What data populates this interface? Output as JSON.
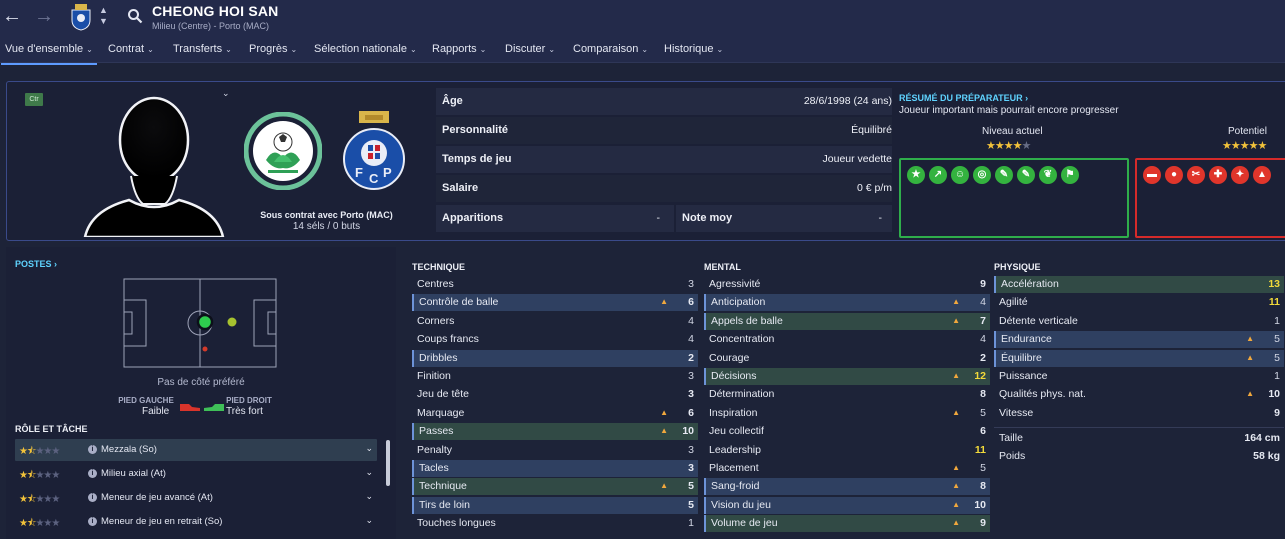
{
  "header": {
    "player_name": "CHEONG HOI SAN",
    "player_subtitle": "Milieu (Centre) - Porto (MAC)"
  },
  "tabs": [
    {
      "label": "Vue d'ensemble"
    },
    {
      "label": "Contrat"
    },
    {
      "label": "Transferts"
    },
    {
      "label": "Progrès"
    },
    {
      "label": "Sélection nationale"
    },
    {
      "label": "Rapports"
    },
    {
      "label": "Discuter"
    },
    {
      "label": "Comparaison"
    },
    {
      "label": "Historique"
    }
  ],
  "profile": {
    "position_badge": "Ctr",
    "contract": "Sous contrat avec Porto (MAC)",
    "caps": "14 séls / 0 buts",
    "info": {
      "age_label": "Âge",
      "age_value": "28/6/1998 (24 ans)",
      "personality_label": "Personnalité",
      "personality_value": "Équilibré",
      "playing_time_label": "Temps de jeu",
      "playing_time_value": "Joueur vedette",
      "salary_label": "Salaire",
      "salary_value": "0 € p/m",
      "appearances_label": "Apparitions",
      "appearances_value": "-",
      "rating_label": "Note moy",
      "rating_value": "-"
    }
  },
  "coach": {
    "title": "RÉSUMÉ DU PRÉPARATEUR ›",
    "summary": "Joueur important mais pourrait encore progresser",
    "current_label": "Niveau actuel",
    "potential_label": "Potentiel",
    "current_stars": 3.5,
    "potential_stars": 4.5,
    "strength_icons": [
      "star-icon",
      "trend-icon",
      "head-icon",
      "target-icon",
      "boot-icon",
      "boot-icon",
      "boots-icon",
      "flag-icon"
    ],
    "weakness_icons": [
      "dumbbell-icon",
      "ball-icon",
      "scissors-icon",
      "cross-icon",
      "foot-icon",
      "cone-icon"
    ]
  },
  "positions": {
    "title": "POSTES ›",
    "preferred_side": "Pas de côté préféré",
    "left_foot_label": "PIED GAUCHE",
    "left_foot_value": "Faible",
    "right_foot_label": "PIED DROIT",
    "right_foot_value": "Très fort"
  },
  "roles": {
    "title": "RÔLE ET TÂCHE",
    "items": [
      {
        "name": "Mezzala (So)",
        "stars": 1.5
      },
      {
        "name": "Milieu axial (At)",
        "stars": 1.5
      },
      {
        "name": "Meneur de jeu avancé (At)",
        "stars": 1.5
      },
      {
        "name": "Meneur de jeu en retrait (So)",
        "stars": 1.5
      }
    ]
  },
  "attributes": {
    "technical_title": "TECHNIQUE",
    "mental_title": "MENTAL",
    "physical_title": "PHYSIQUE",
    "technical": [
      {
        "name": "Centres",
        "value": "3"
      },
      {
        "name": "Contrôle de balle",
        "value": "6"
      },
      {
        "name": "Corners",
        "value": "4"
      },
      {
        "name": "Coups francs",
        "value": "4"
      },
      {
        "name": "Dribbles",
        "value": "2"
      },
      {
        "name": "Finition",
        "value": "3"
      },
      {
        "name": "Jeu de tête",
        "value": "3"
      },
      {
        "name": "Marquage",
        "value": "6"
      },
      {
        "name": "Passes",
        "value": "10"
      },
      {
        "name": "Penalty",
        "value": "3"
      },
      {
        "name": "Tacles",
        "value": "3"
      },
      {
        "name": "Technique",
        "value": "5"
      },
      {
        "name": "Tirs de loin",
        "value": "5"
      },
      {
        "name": "Touches longues",
        "value": "1"
      }
    ],
    "mental": [
      {
        "name": "Agressivité",
        "value": "9"
      },
      {
        "name": "Anticipation",
        "value": "4"
      },
      {
        "name": "Appels de balle",
        "value": "7"
      },
      {
        "name": "Concentration",
        "value": "4"
      },
      {
        "name": "Courage",
        "value": "2"
      },
      {
        "name": "Décisions",
        "value": "12"
      },
      {
        "name": "Détermination",
        "value": "8"
      },
      {
        "name": "Inspiration",
        "value": "5"
      },
      {
        "name": "Jeu collectif",
        "value": "6"
      },
      {
        "name": "Leadership",
        "value": "11"
      },
      {
        "name": "Placement",
        "value": "5"
      },
      {
        "name": "Sang-froid",
        "value": "8"
      },
      {
        "name": "Vision du jeu",
        "value": "10"
      },
      {
        "name": "Volume de jeu",
        "value": "9"
      }
    ],
    "physical": [
      {
        "name": "Accélération",
        "value": "13"
      },
      {
        "name": "Agilité",
        "value": "11"
      },
      {
        "name": "Détente verticale",
        "value": "1"
      },
      {
        "name": "Endurance",
        "value": "5"
      },
      {
        "name": "Équilibre",
        "value": "5"
      },
      {
        "name": "Puissance",
        "value": "1"
      },
      {
        "name": "Qualités phys. nat.",
        "value": "10"
      },
      {
        "name": "Vitesse",
        "value": "9"
      }
    ],
    "height_label": "Taille",
    "height_value": "164 cm",
    "weight_label": "Poids",
    "weight_value": "58 kg"
  }
}
